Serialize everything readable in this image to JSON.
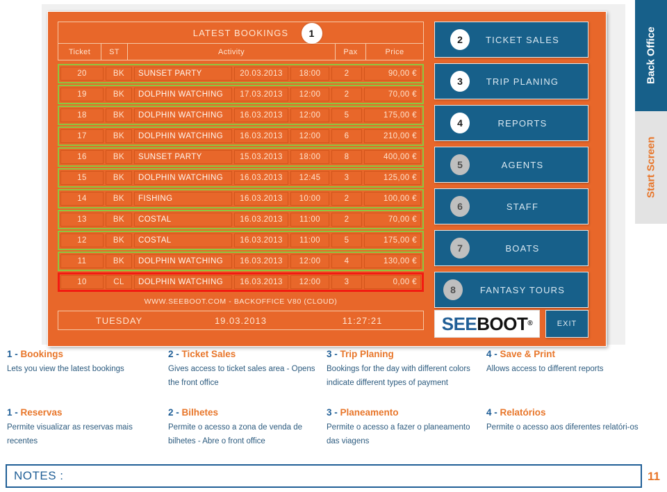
{
  "screen": {
    "bookings_panel": {
      "title": "LATEST BOOKINGS",
      "badge": "1",
      "columns": [
        "Ticket",
        "ST",
        "Activity",
        "Pax",
        "Price"
      ],
      "rows": [
        {
          "ticket": "20",
          "st": "BK",
          "activity": "SUNSET PARTY",
          "date": "20.03.2013",
          "time": "18:00",
          "pax": "2",
          "price": "90,00 €",
          "flag": "green"
        },
        {
          "ticket": "19",
          "st": "BK",
          "activity": "DOLPHIN WATCHING",
          "date": "17.03.2013",
          "time": "12:00",
          "pax": "2",
          "price": "70,00 €",
          "flag": "green"
        },
        {
          "ticket": "18",
          "st": "BK",
          "activity": "DOLPHIN WATCHING",
          "date": "16.03.2013",
          "time": "12:00",
          "pax": "5",
          "price": "175,00 €",
          "flag": "green"
        },
        {
          "ticket": "17",
          "st": "BK",
          "activity": "DOLPHIN WATCHING",
          "date": "16.03.2013",
          "time": "12:00",
          "pax": "6",
          "price": "210,00 €",
          "flag": "green"
        },
        {
          "ticket": "16",
          "st": "BK",
          "activity": "SUNSET PARTY",
          "date": "15.03.2013",
          "time": "18:00",
          "pax": "8",
          "price": "400,00 €",
          "flag": "green"
        },
        {
          "ticket": "15",
          "st": "BK",
          "activity": "DOLPHIN WATCHING",
          "date": "16.03.2013",
          "time": "12:45",
          "pax": "3",
          "price": "125,00 €",
          "flag": "green"
        },
        {
          "ticket": "14",
          "st": "BK",
          "activity": "FISHING",
          "date": "16.03.2013",
          "time": "10:00",
          "pax": "2",
          "price": "100,00 €",
          "flag": "green"
        },
        {
          "ticket": "13",
          "st": "BK",
          "activity": "COSTAL",
          "date": "16.03.2013",
          "time": "11:00",
          "pax": "2",
          "price": "70,00 €",
          "flag": "green"
        },
        {
          "ticket": "12",
          "st": "BK",
          "activity": "COSTAL",
          "date": "16.03.2013",
          "time": "11:00",
          "pax": "5",
          "price": "175,00 €",
          "flag": "green"
        },
        {
          "ticket": "11",
          "st": "BK",
          "activity": "DOLPHIN WATCHING",
          "date": "16.03.2013",
          "time": "12:00",
          "pax": "4",
          "price": "130,00 €",
          "flag": "green"
        },
        {
          "ticket": "10",
          "st": "CL",
          "activity": "DOLPHIN WATCHING",
          "date": "16.03.2013",
          "time": "12:00",
          "pax": "3",
          "price": "0,00 €",
          "flag": "red"
        }
      ],
      "url_line": "WWW.SEEBOOT.COM - BACKOFFICE V80  (CLOUD)",
      "clock": {
        "weekday": "TUESDAY",
        "date": "19.03.2013",
        "time": "11:27:21"
      }
    },
    "menu": {
      "buttons": [
        {
          "num": "2",
          "label": "TICKET SALES",
          "state": "active"
        },
        {
          "num": "3",
          "label": "TRIP PLANING",
          "state": "active"
        },
        {
          "num": "4",
          "label": "REPORTS",
          "state": "active"
        },
        {
          "num": "5",
          "label": "AGENTS",
          "state": "dim"
        },
        {
          "num": "6",
          "label": "STAFF",
          "state": "dim"
        },
        {
          "num": "7",
          "label": "BOATS",
          "state": "dim"
        },
        {
          "num": "8",
          "label": "FANTASY TOURS",
          "state": "dim"
        }
      ],
      "logo": {
        "part1": "SEE",
        "part2": "BOOT",
        "reg": "®"
      },
      "exit_label": "EXIT"
    },
    "side_tabs": [
      {
        "label": "Back Office",
        "state": "selected"
      },
      {
        "label": "Start Screen",
        "state": "normal"
      }
    ],
    "colors": {
      "orange": "#e8672a",
      "orange_text": "#e8762a",
      "blue": "#17608a",
      "blue_text": "#1f5e96",
      "green_flag": "#8dc63f",
      "red_flag": "#f21b12"
    }
  },
  "descriptions_en": [
    {
      "heading_num": "1 - ",
      "heading": "Bookings",
      "body": "Lets you view the latest bookings"
    },
    {
      "heading_num": "2 - ",
      "heading": " Ticket Sales",
      "body": "Gives access to ticket sales area - Opens the front office"
    },
    {
      "heading_num": "3 - ",
      "heading": "Trip Planing",
      "body": "Bookings for the day with different colors indicate different types of payment"
    },
    {
      "heading_num": "4 - ",
      "heading": "Save & Print",
      "body": "Allows access to different reports"
    }
  ],
  "descriptions_pt": [
    {
      "heading_num": "1 - ",
      "heading": "Reservas",
      "body": "Permite visualizar as reservas mais recentes"
    },
    {
      "heading_num": "2 - ",
      "heading": "Bilhetes",
      "body": "Permite o acesso a zona de venda de bilhetes - Abre o front office"
    },
    {
      "heading_num": "3 - ",
      "heading": "Planeamento",
      "body": "Permite o acesso a fazer o planeamento das viagens"
    },
    {
      "heading_num": "4 - ",
      "heading": "Relatórios",
      "body": "Permite o acesso aos diferentes relatóri-os"
    }
  ],
  "footer": {
    "notes_label": "NOTES :",
    "page_number": "11"
  }
}
